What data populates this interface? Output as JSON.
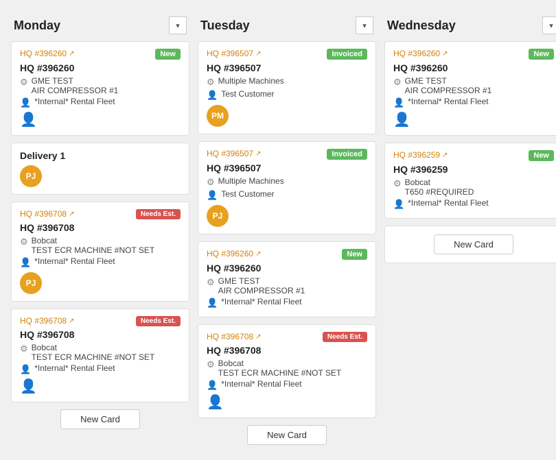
{
  "columns": [
    {
      "id": "monday",
      "title": "Monday",
      "cards": [
        {
          "id": "mon-1",
          "hq_link": "HQ #396260",
          "badge": "New",
          "badge_class": "badge-new",
          "title": "HQ #396260",
          "machine_line1": "GME TEST",
          "machine_line2": "AIR COMPRESSOR #1",
          "customer": "*Internal* Rental Fleet",
          "avatar": null,
          "avatar_initials": null,
          "show_person_icon": true
        },
        {
          "id": "mon-delivery",
          "hq_link": null,
          "badge": null,
          "badge_class": null,
          "title": "Delivery 1",
          "machine_line1": null,
          "machine_line2": null,
          "customer": null,
          "avatar": "PJ",
          "avatar_class": "avatar-orange",
          "show_person_icon": false
        },
        {
          "id": "mon-2",
          "hq_link": "HQ #396708",
          "badge": "Needs Est.",
          "badge_class": "badge-needs-est",
          "title": "HQ #396708",
          "machine_line1": "Bobcat",
          "machine_line2": "TEST ECR MACHINE #NOT SET",
          "customer": "*Internal* Rental Fleet",
          "avatar": "PJ",
          "avatar_class": "avatar-orange",
          "show_person_icon": false
        },
        {
          "id": "mon-3",
          "hq_link": "HQ #396708",
          "badge": "Needs Est.",
          "badge_class": "badge-needs-est",
          "title": "HQ #396708",
          "machine_line1": "Bobcat",
          "machine_line2": "TEST ECR MACHINE #NOT SET",
          "customer": "*Internal* Rental Fleet",
          "avatar": null,
          "avatar_class": null,
          "show_person_icon": true
        }
      ],
      "new_card_label": "New Card"
    },
    {
      "id": "tuesday",
      "title": "Tuesday",
      "cards": [
        {
          "id": "tue-1",
          "hq_link": "HQ #396507",
          "badge": "Invoiced",
          "badge_class": "badge-invoiced",
          "title": "HQ #396507",
          "machine_line1": "Multiple Machines",
          "machine_line2": null,
          "customer": "Test Customer",
          "avatar": "PM",
          "avatar_class": "avatar-orange",
          "show_person_icon": false
        },
        {
          "id": "tue-2",
          "hq_link": "HQ #396507",
          "badge": "Invoiced",
          "badge_class": "badge-invoiced",
          "title": "HQ #396507",
          "machine_line1": "Multiple Machines",
          "machine_line2": null,
          "customer": "Test Customer",
          "avatar": "PJ",
          "avatar_class": "avatar-orange",
          "show_person_icon": false
        },
        {
          "id": "tue-3",
          "hq_link": "HQ #396260",
          "badge": "New",
          "badge_class": "badge-new",
          "title": "HQ #396260",
          "machine_line1": "GME TEST",
          "machine_line2": "AIR COMPRESSOR #1",
          "customer": "*Internal* Rental Fleet",
          "avatar": null,
          "avatar_class": null,
          "show_person_icon": false
        },
        {
          "id": "tue-4",
          "hq_link": "HQ #396708",
          "badge": "Needs Est.",
          "badge_class": "badge-needs-est",
          "title": "HQ #396708",
          "machine_line1": "Bobcat",
          "machine_line2": "TEST ECR MACHINE #NOT SET",
          "customer": "*Internal* Rental Fleet",
          "avatar": null,
          "avatar_class": null,
          "show_person_icon": true
        }
      ],
      "new_card_label": "New Card"
    },
    {
      "id": "wednesday",
      "title": "Wednesday",
      "cards": [
        {
          "id": "wed-1",
          "hq_link": "HQ #396260",
          "badge": "New",
          "badge_class": "badge-new",
          "title": "HQ #396260",
          "machine_line1": "GME TEST",
          "machine_line2": "AIR COMPRESSOR #1",
          "customer": "*Internal* Rental Fleet",
          "avatar": null,
          "avatar_class": null,
          "show_person_icon": true
        },
        {
          "id": "wed-2",
          "hq_link": "HQ #396259",
          "badge": "New",
          "badge_class": "badge-new",
          "title": "HQ #396259",
          "machine_line1": "Bobcat",
          "machine_line2": "T650 #REQUIRED",
          "customer": "*Internal* Rental Fleet",
          "avatar": null,
          "avatar_class": null,
          "show_person_icon": false
        }
      ],
      "new_card_label": "New Card",
      "show_new_card_standalone": true
    }
  ]
}
